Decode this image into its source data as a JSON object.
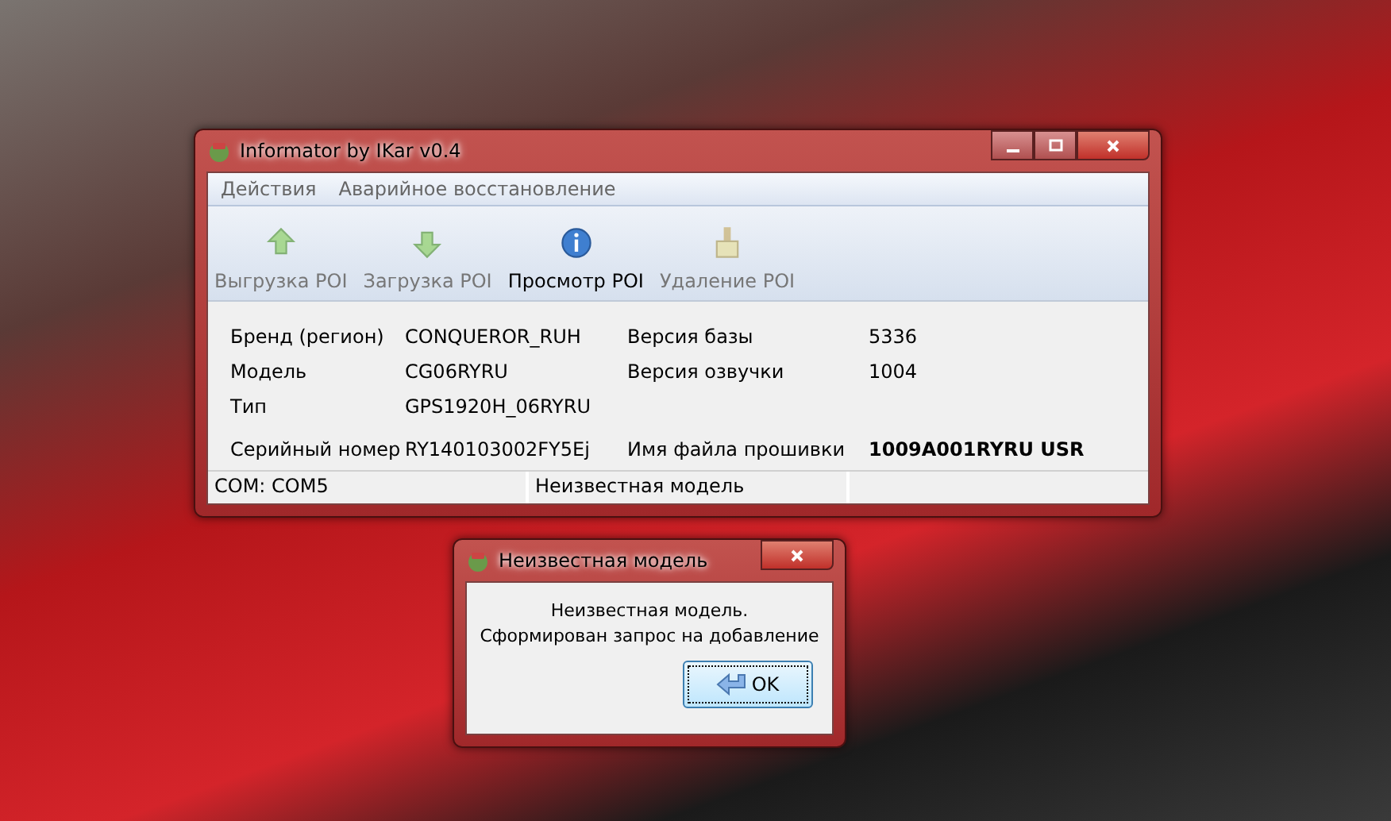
{
  "window": {
    "title": "Informator by IKar v0.4"
  },
  "menu": [
    "Действия",
    "Аварийное восстановление"
  ],
  "toolbar": [
    {
      "kind": "upload",
      "label": "Выгрузка POI",
      "disabled": true
    },
    {
      "kind": "download",
      "label": "Загрузка POI",
      "disabled": true
    },
    {
      "kind": "info",
      "label": "Просмотр POI",
      "disabled": false
    },
    {
      "kind": "clear",
      "label": "Удаление POI",
      "disabled": true
    }
  ],
  "info_rows": [
    {
      "label": "Бренд (регион)",
      "value": "CONQUEROR_RUH",
      "right_label": "Версия базы",
      "right_value": "5336",
      "bold": false
    },
    {
      "label": "Модель",
      "value": "CG06RYRU",
      "right_label": "Версия озвучки",
      "right_value": "1004",
      "bold": false
    },
    {
      "label": "Тип",
      "value": "GPS1920H_06RYRU"
    },
    {
      "label": "Серийный номер",
      "value": "RY140103002FY5Ej",
      "right_label": "Имя файла прошивки",
      "right_value": "1009A001RYRU USR",
      "bold": true
    }
  ],
  "status_bar": [
    "COM: COM5",
    "Неизвестная модель"
  ],
  "dialog": {
    "title": "Неизвестная модель",
    "message": [
      "Неизвестная модель.",
      "Сформирован запрос на добавление"
    ],
    "button": "OK"
  }
}
